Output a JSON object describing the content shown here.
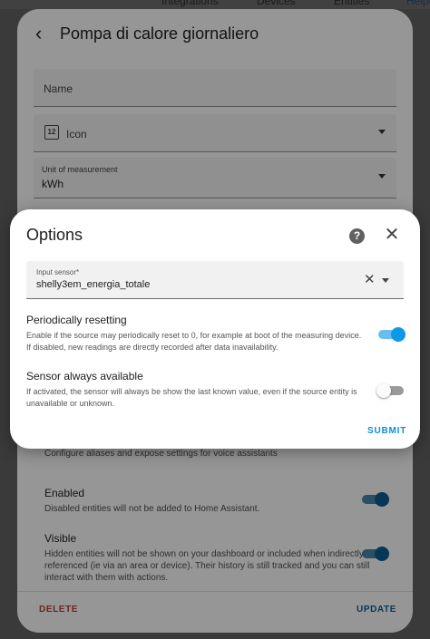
{
  "background_tabs": {
    "integrations": "Integrations",
    "devices": "Devices",
    "entities": "Entities",
    "helpers": "Helpers"
  },
  "entity_dialog": {
    "title": "Pompa di calore giornaliero",
    "name_placeholder": "Name",
    "icon_label": "Icon",
    "unit_label": "Unit of measurement",
    "unit_value": "kWh",
    "voice_description": "Configure aliases and expose settings for voice assistants",
    "enabled": {
      "title": "Enabled",
      "description": "Disabled entities will not be added to Home Assistant.",
      "on": true
    },
    "visible": {
      "title": "Visible",
      "description": "Hidden entities will not be shown on your dashboard or included when indirectly referenced (ie via an area or device). Their history is still tracked and you can still interact with them with actions.",
      "on": true
    },
    "delete_label": "DELETE",
    "update_label": "UPDATE"
  },
  "options_dialog": {
    "title": "Options",
    "input_sensor_label": "Input sensor*",
    "input_sensor_value": "shelly3em_energia_totale",
    "periodically_resetting": {
      "title": "Periodically resetting",
      "description": "Enable if the source may periodically reset to 0, for example at boot of the measuring device. If disabled, new readings are directly recorded after data inavailability.",
      "on": true
    },
    "sensor_always_available": {
      "title": "Sensor always available",
      "description": "If activated, the sensor will always be show the last known value, even if the source entity is unavailable or unknown.",
      "on": false
    },
    "submit_label": "SUBMIT"
  },
  "colors": {
    "accent": "#0b8fd6",
    "delete": "#b13a30",
    "toggle_on": "#0d98e8"
  }
}
